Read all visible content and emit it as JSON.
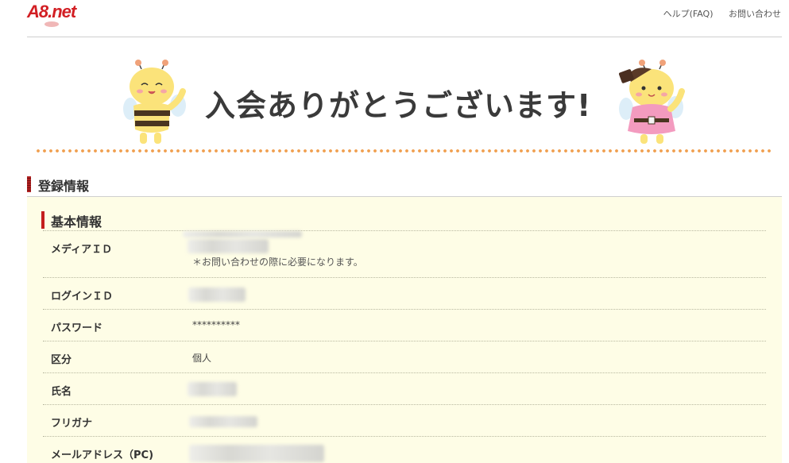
{
  "header": {
    "logo_text": "A8.net",
    "links": [
      "ヘルプ(FAQ)",
      "お問い合わせ"
    ]
  },
  "hero": {
    "title": "入会ありがとうございます!"
  },
  "section": {
    "title": "登録情報"
  },
  "panel": {
    "title": "基本情報",
    "rows": [
      {
        "label": "メディアＩＤ",
        "value": "",
        "note": "＊お問い合わせの際に必要になります。"
      },
      {
        "label": "ログインＩＤ",
        "value": ""
      },
      {
        "label": "パスワード",
        "value": "**********"
      },
      {
        "label": "区分",
        "value": "個人"
      },
      {
        "label": "氏名",
        "value": ""
      },
      {
        "label": "フリガナ",
        "value": ""
      },
      {
        "label": "メールアドレス（PC)",
        "value": ""
      }
    ]
  },
  "colors": {
    "brand_red": "#d21f24",
    "panel_bg": "#fefde6",
    "dot_orange": "#f0a050"
  }
}
